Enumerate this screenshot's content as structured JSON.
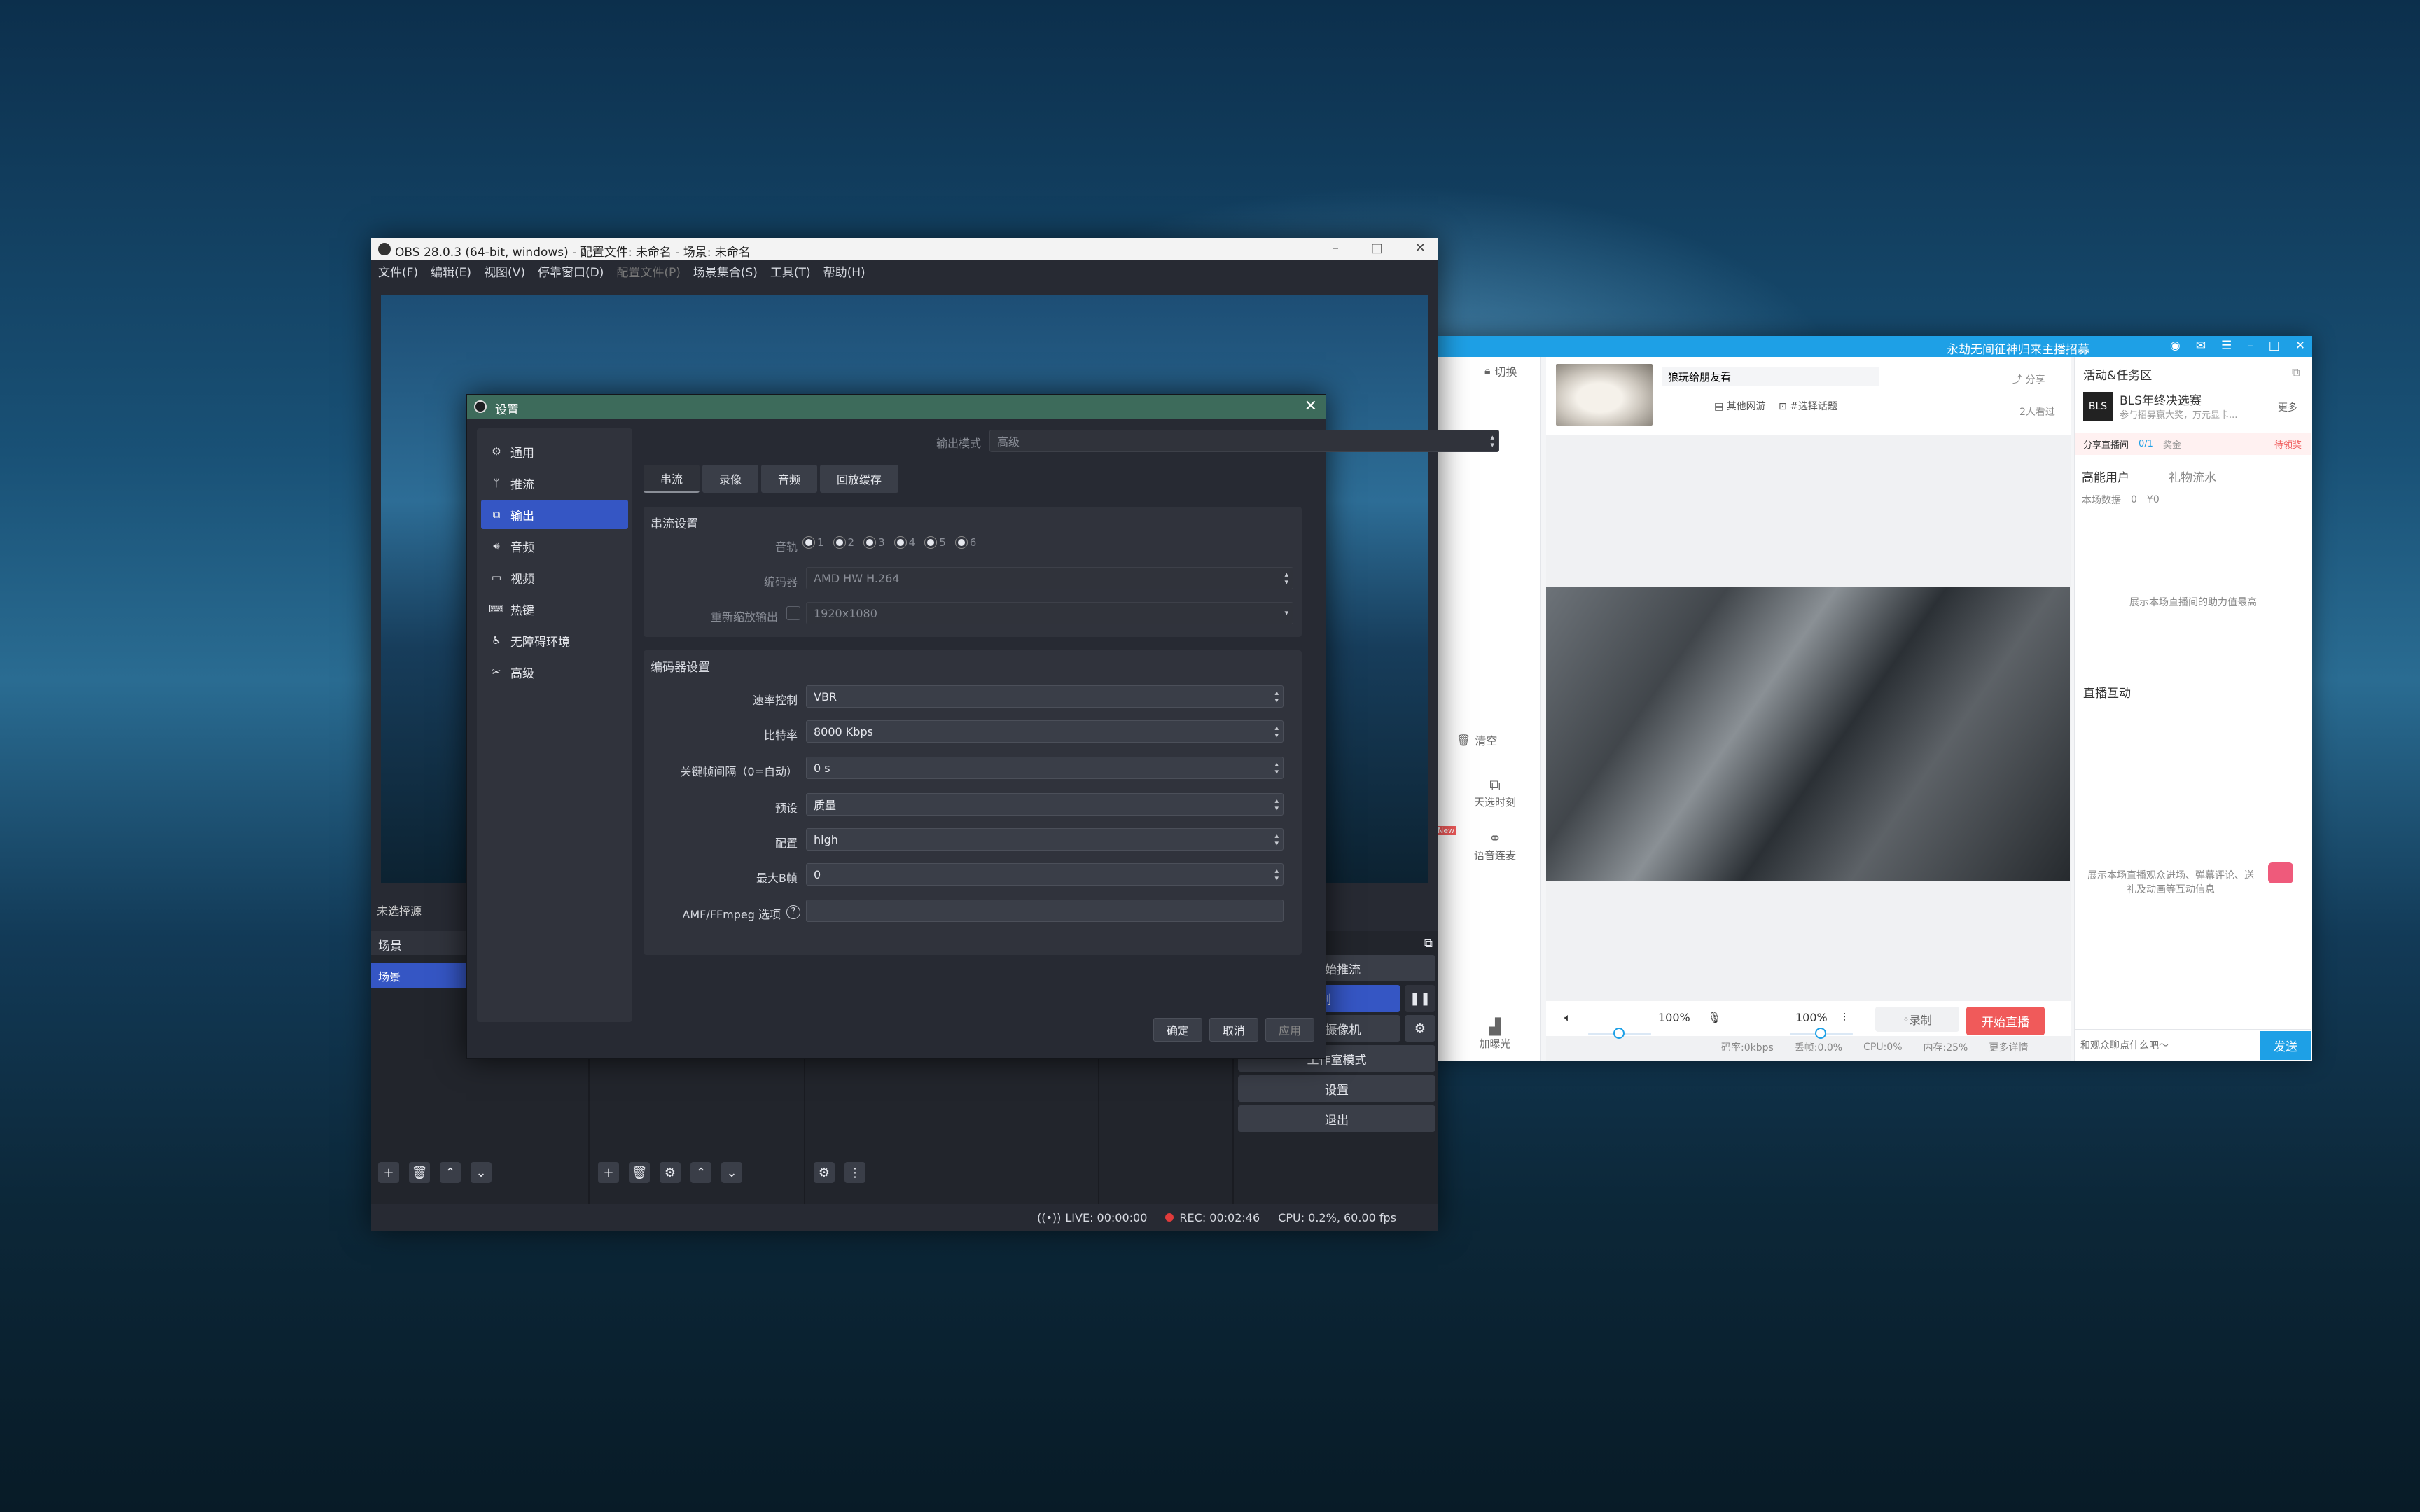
{
  "obs": {
    "title": "OBS 28.0.3 (64-bit, windows) - 配置文件: 未命名 - 场景: 未命名",
    "menu": [
      "文件(F)",
      "编辑(E)",
      "视图(V)",
      "停靠窗口(D)",
      "配置文件(P)",
      "场景集合(S)",
      "工具(T)",
      "帮助(H)"
    ],
    "no_source": "未选择源",
    "scenes_header": "场景",
    "scene_item": "场景",
    "controls": {
      "start_stream": "开始推流",
      "record": "录制",
      "virtual_cam": "启动虚拟摄像机",
      "studio_mode": "工作室模式",
      "settings": "设置",
      "exit": "退出"
    },
    "status": {
      "live": "LIVE: 00:00:00",
      "rec": "REC: 00:02:46",
      "cpu": "CPU: 0.2%, 60.00 fps"
    }
  },
  "settings": {
    "title": "设置",
    "sidebar": [
      "通用",
      "推流",
      "输出",
      "音频",
      "视频",
      "热键",
      "无障碍环境",
      "高级"
    ],
    "output_mode_label": "输出模式",
    "output_mode_value": "高级",
    "tabs": [
      "串流",
      "录像",
      "音频",
      "回放缓存"
    ],
    "stream_group": {
      "title": "串流设置",
      "track_label": "音轨",
      "tracks": [
        "1",
        "2",
        "3",
        "4",
        "5",
        "6"
      ],
      "encoder_label": "编码器",
      "encoder_value": "AMD HW H.264",
      "rescale_label": "重新缩放输出",
      "rescale_value": "1920x1080"
    },
    "encoder_group": {
      "title": "编码器设置",
      "rows": [
        {
          "label": "速率控制",
          "value": "VBR"
        },
        {
          "label": "比特率",
          "value": "8000 Kbps"
        },
        {
          "label": "关键帧间隔（0=自动）",
          "value": "0 s"
        },
        {
          "label": "预设",
          "value": "质量"
        },
        {
          "label": "配置",
          "value": "high"
        },
        {
          "label": "最大B帧",
          "value": "0"
        }
      ],
      "amf_label": "AMF/FFmpeg 选项",
      "amf_value": ""
    },
    "buttons": {
      "ok": "确定",
      "cancel": "取消",
      "apply": "应用"
    }
  },
  "bls": {
    "title": "永劫无间征神归来主播招募",
    "switch": "切换",
    "clear": "清空",
    "room_title": "狼玩给朋友看",
    "tag1": "其他网游",
    "tag2": "#选择话题",
    "share": "分享",
    "viewers": "2人看过",
    "left_items": [
      "天选时刻",
      "语音连麦",
      "加曝光"
    ],
    "new_badge": "New",
    "volume1": "100%",
    "volume2": "100%",
    "record_btn": "录制",
    "start_live": "开始直播",
    "stats": [
      "码率:0kbps",
      "丢帧:0.0%",
      "CPU:0%",
      "内存:25%",
      "更多详情"
    ],
    "activity_title": "活动&任务区",
    "bls_badge": "BLS",
    "activity_name": "BLS年终决选赛",
    "activity_sub": "参与招募赢大奖，万元显卡...",
    "more": "更多",
    "share_room": "分享直播间",
    "share_progress": "0/1",
    "share_reward": "奖金",
    "pending": "待领奖",
    "hq_users": "高能用户",
    "gift_flow": "礼物流水",
    "this_data": "本场数据",
    "count1": "0",
    "count2": "¥0",
    "hq_empty": "展示本场直播间的助力值最高",
    "interact_title": "直播互动",
    "interact_empty": "展示本场直播观众进场、弹幕评论、送礼及动画等互动信息",
    "chat_placeholder": "和观众聊点什么吧～",
    "send": "发送"
  }
}
